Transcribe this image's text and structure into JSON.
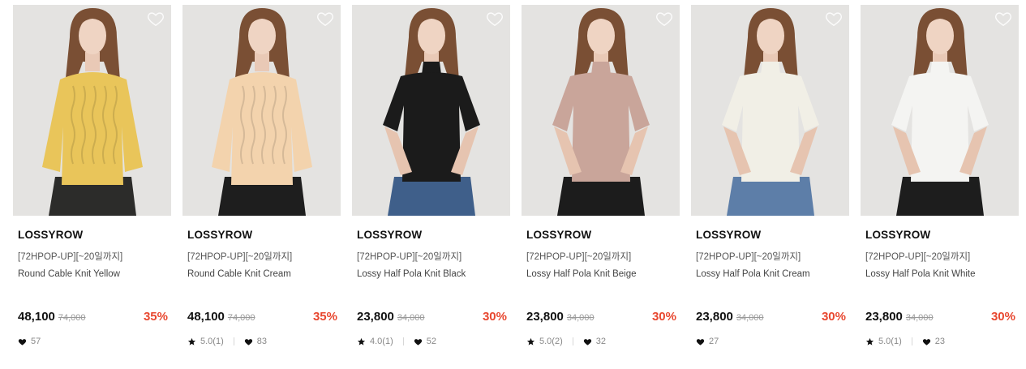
{
  "products": [
    {
      "brand": "LOSSYROW",
      "promo": "[72HPOP-UP][~20일까지]",
      "name": "Round Cable Knit Yellow",
      "price": "48,100",
      "original_price": "74,000",
      "discount": "35%",
      "rating": "",
      "likes": "57",
      "top_color": "#e9c55a",
      "bottom_color": "#2c2c2a",
      "style": "sweater"
    },
    {
      "brand": "LOSSYROW",
      "promo": "[72HPOP-UP][~20일까지]",
      "name": "Round Cable Knit Cream",
      "price": "48,100",
      "original_price": "74,000",
      "discount": "35%",
      "rating": "5.0(1)",
      "likes": "83",
      "top_color": "#f3d3ad",
      "bottom_color": "#1e1e1e",
      "style": "sweater"
    },
    {
      "brand": "LOSSYROW",
      "promo": "[72HPOP-UP][~20일까지]",
      "name": "Lossy Half Pola Knit Black",
      "price": "23,800",
      "original_price": "34,000",
      "discount": "30%",
      "rating": "4.0(1)",
      "likes": "52",
      "top_color": "#1b1b1b",
      "bottom_color": "#3f5f8a",
      "style": "pola"
    },
    {
      "brand": "LOSSYROW",
      "promo": "[72HPOP-UP][~20일까지]",
      "name": "Lossy Half Pola Knit Beige",
      "price": "23,800",
      "original_price": "34,000",
      "discount": "30%",
      "rating": "5.0(2)",
      "likes": "32",
      "top_color": "#c9a59a",
      "bottom_color": "#1c1c1c",
      "style": "pola"
    },
    {
      "brand": "LOSSYROW",
      "promo": "[72HPOP-UP][~20일까지]",
      "name": "Lossy Half Pola Knit Cream",
      "price": "23,800",
      "original_price": "34,000",
      "discount": "30%",
      "rating": "",
      "likes": "27",
      "top_color": "#f1efe6",
      "bottom_color": "#5d7ea8",
      "style": "pola"
    },
    {
      "brand": "LOSSYROW",
      "promo": "[72HPOP-UP][~20일까지]",
      "name": "Lossy Half Pola Knit White",
      "price": "23,800",
      "original_price": "34,000",
      "discount": "30%",
      "rating": "5.0(1)",
      "likes": "23",
      "top_color": "#f4f4f2",
      "bottom_color": "#1d1d1d",
      "style": "pola"
    }
  ],
  "colors": {
    "accent_discount": "#e8472f",
    "text_main": "#111111",
    "text_muted": "#888888"
  },
  "icons": {
    "rating": "star-icon",
    "likes": "heart-icon",
    "wishlist": "heart-outline-icon"
  }
}
